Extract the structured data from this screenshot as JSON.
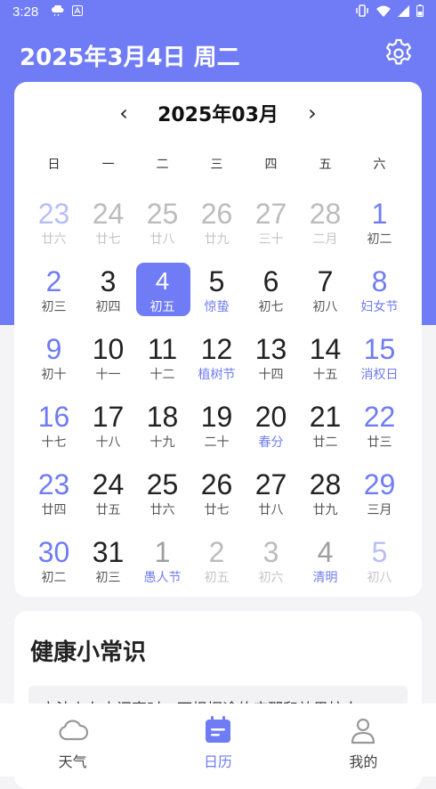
{
  "status": {
    "time": "3:28"
  },
  "header": {
    "date_title": "2025年3月4日 周二"
  },
  "calendar": {
    "month_title": "2025年03月",
    "prev_label": "‹",
    "next_label": "›",
    "weekdays": [
      "日",
      "一",
      "二",
      "三",
      "四",
      "五",
      "六"
    ],
    "weeks": [
      [
        {
          "day": "23",
          "lunar": "廿六",
          "other": true,
          "weekend": true
        },
        {
          "day": "24",
          "lunar": "廿七",
          "other": true
        },
        {
          "day": "25",
          "lunar": "廿八",
          "other": true
        },
        {
          "day": "26",
          "lunar": "廿九",
          "other": true
        },
        {
          "day": "27",
          "lunar": "三十",
          "other": true
        },
        {
          "day": "28",
          "lunar": "二月",
          "other": true
        },
        {
          "day": "1",
          "lunar": "初二",
          "weekend": true
        }
      ],
      [
        {
          "day": "2",
          "lunar": "初三",
          "weekend": true
        },
        {
          "day": "3",
          "lunar": "初四"
        },
        {
          "day": "4",
          "lunar": "初五",
          "selected": true
        },
        {
          "day": "5",
          "lunar": "惊蛰",
          "festival": true
        },
        {
          "day": "6",
          "lunar": "初七"
        },
        {
          "day": "7",
          "lunar": "初八"
        },
        {
          "day": "8",
          "lunar": "妇女节",
          "weekend": true,
          "festival": true
        }
      ],
      [
        {
          "day": "9",
          "lunar": "初十",
          "weekend": true
        },
        {
          "day": "10",
          "lunar": "十一"
        },
        {
          "day": "11",
          "lunar": "十二"
        },
        {
          "day": "12",
          "lunar": "植树节",
          "festival": true
        },
        {
          "day": "13",
          "lunar": "十四"
        },
        {
          "day": "14",
          "lunar": "十五"
        },
        {
          "day": "15",
          "lunar": "消权日",
          "weekend": true,
          "festival": true
        }
      ],
      [
        {
          "day": "16",
          "lunar": "十七",
          "weekend": true
        },
        {
          "day": "17",
          "lunar": "十八"
        },
        {
          "day": "18",
          "lunar": "十九"
        },
        {
          "day": "19",
          "lunar": "二十"
        },
        {
          "day": "20",
          "lunar": "春分",
          "festival": true
        },
        {
          "day": "21",
          "lunar": "廿二"
        },
        {
          "day": "22",
          "lunar": "廿三",
          "weekend": true
        }
      ],
      [
        {
          "day": "23",
          "lunar": "廿四",
          "weekend": true
        },
        {
          "day": "24",
          "lunar": "廿五"
        },
        {
          "day": "25",
          "lunar": "廿六"
        },
        {
          "day": "26",
          "lunar": "廿七"
        },
        {
          "day": "27",
          "lunar": "廿八"
        },
        {
          "day": "28",
          "lunar": "廿九"
        },
        {
          "day": "29",
          "lunar": "三月",
          "weekend": true
        }
      ],
      [
        {
          "day": "30",
          "lunar": "初二",
          "weekend": true
        },
        {
          "day": "31",
          "lunar": "初三"
        },
        {
          "day": "1",
          "lunar": "愚人节",
          "other": true,
          "festival": true
        },
        {
          "day": "2",
          "lunar": "初五",
          "other": true
        },
        {
          "day": "3",
          "lunar": "初六",
          "other": true
        },
        {
          "day": "4",
          "lunar": "清明",
          "other": true,
          "festival": true
        },
        {
          "day": "5",
          "lunar": "初八",
          "other": true,
          "weekend": true
        }
      ]
    ]
  },
  "health": {
    "title": "健康小常识",
    "text": "立法上在中间衰时，可根据途的应那和效果拉人"
  },
  "bottom_nav": {
    "items": [
      {
        "label": "天气",
        "icon": "cloud-icon"
      },
      {
        "label": "日历",
        "icon": "calendar-icon",
        "active": true
      },
      {
        "label": "我的",
        "icon": "user-icon"
      }
    ]
  },
  "colors": {
    "accent": "#6f7cf5",
    "background": "#f4f4f6"
  }
}
